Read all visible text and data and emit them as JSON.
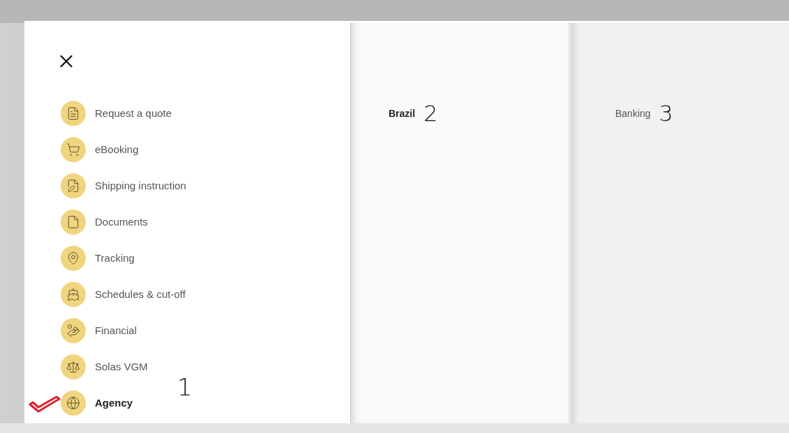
{
  "menu": {
    "items": [
      {
        "label": "Request a quote",
        "selected": false
      },
      {
        "label": "eBooking",
        "selected": false
      },
      {
        "label": "Shipping instruction",
        "selected": false
      },
      {
        "label": "Documents",
        "selected": false
      },
      {
        "label": "Tracking",
        "selected": false
      },
      {
        "label": "Schedules & cut-off",
        "selected": false
      },
      {
        "label": "Financial",
        "selected": false
      },
      {
        "label": "Solas VGM",
        "selected": false
      },
      {
        "label": "Agency",
        "selected": true,
        "check_mark": true
      }
    ],
    "annotation": "1"
  },
  "countries": {
    "items": [
      {
        "label": "Brazil",
        "selected": true
      }
    ],
    "annotation": "2"
  },
  "categories": {
    "items": [
      {
        "label": "Banking",
        "selected": false
      }
    ],
    "annotation": "3"
  }
}
